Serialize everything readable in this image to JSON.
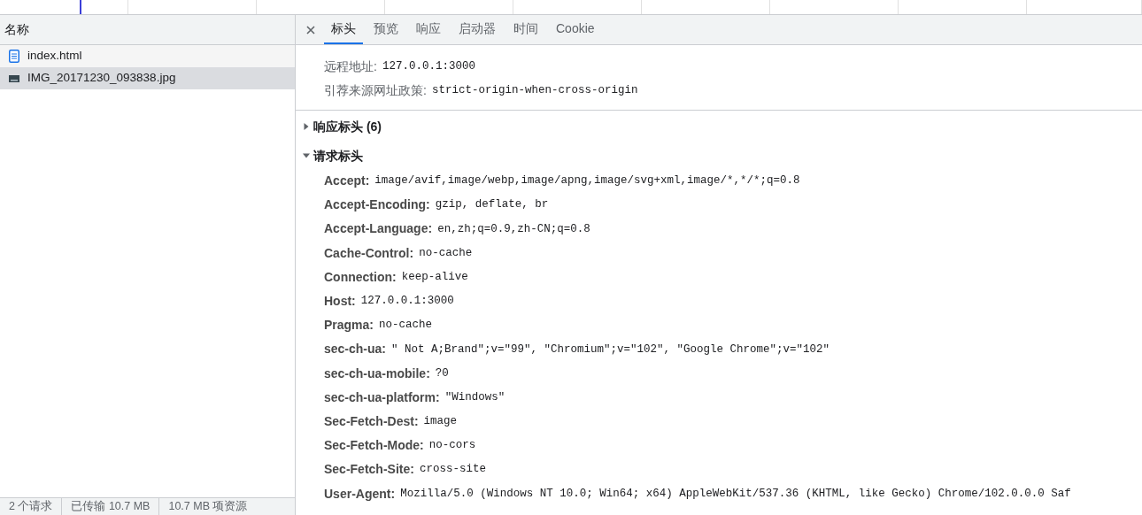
{
  "request_list": {
    "header": "名称",
    "items": [
      {
        "name": "index.html",
        "kind": "document",
        "selected": false
      },
      {
        "name": "IMG_20171230_093838.jpg",
        "kind": "image",
        "selected": true
      }
    ]
  },
  "status_bar": [
    "2 个请求",
    "已传输 10.7 MB",
    "10.7 MB 项资源"
  ],
  "tabs": [
    {
      "label": "标头",
      "selected": true
    },
    {
      "label": "预览",
      "selected": false
    },
    {
      "label": "响应",
      "selected": false
    },
    {
      "label": "启动器",
      "selected": false
    },
    {
      "label": "时间",
      "selected": false
    },
    {
      "label": "Cookie",
      "selected": false
    }
  ],
  "general": [
    {
      "name": "远程地址:",
      "value": "127.0.0.1:3000"
    },
    {
      "name": "引荐来源网址政策:",
      "value": "strict-origin-when-cross-origin"
    }
  ],
  "sections": [
    {
      "title": "响应标头 (6)",
      "expanded": false
    },
    {
      "title": "请求标头",
      "expanded": true,
      "headers": [
        {
          "name": "Accept:",
          "value": "image/avif,image/webp,image/apng,image/svg+xml,image/*,*/*;q=0.8"
        },
        {
          "name": "Accept-Encoding:",
          "value": "gzip, deflate, br"
        },
        {
          "name": "Accept-Language:",
          "value": "en,zh;q=0.9,zh-CN;q=0.8"
        },
        {
          "name": "Cache-Control:",
          "value": "no-cache"
        },
        {
          "name": "Connection:",
          "value": "keep-alive"
        },
        {
          "name": "Host:",
          "value": "127.0.0.1:3000"
        },
        {
          "name": "Pragma:",
          "value": "no-cache"
        },
        {
          "name": "sec-ch-ua:",
          "value": "\" Not A;Brand\";v=\"99\", \"Chromium\";v=\"102\", \"Google Chrome\";v=\"102\""
        },
        {
          "name": "sec-ch-ua-mobile:",
          "value": "?0"
        },
        {
          "name": "sec-ch-ua-platform:",
          "value": "\"Windows\""
        },
        {
          "name": "Sec-Fetch-Dest:",
          "value": "image"
        },
        {
          "name": "Sec-Fetch-Mode:",
          "value": "no-cors"
        },
        {
          "name": "Sec-Fetch-Site:",
          "value": "cross-site"
        },
        {
          "name": "User-Agent:",
          "value": "Mozilla/5.0 (Windows NT 10.0; Win64; x64) AppleWebKit/537.36 (KHTML, like Gecko) Chrome/102.0.0.0 Saf"
        }
      ]
    }
  ]
}
